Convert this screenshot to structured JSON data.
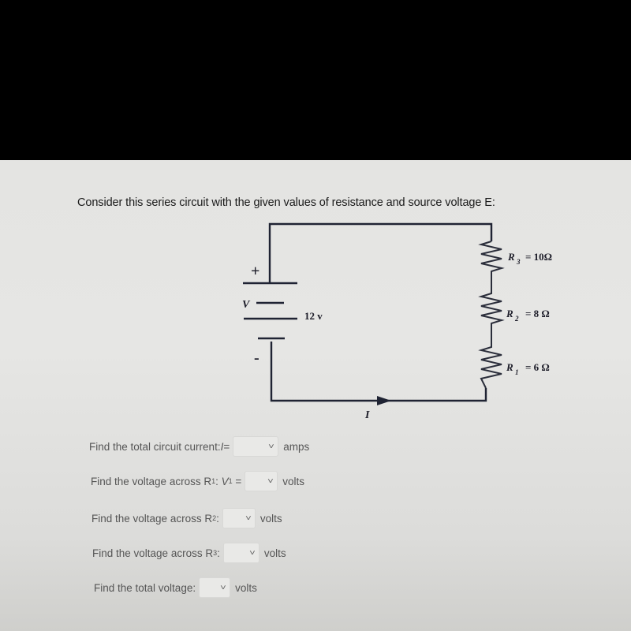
{
  "prompt": "Consider this series circuit with the given values of resistance and source voltage E:",
  "circuit": {
    "battery": {
      "plus_sign": "+",
      "minus_sign": "-",
      "symbol_label": "V",
      "voltage_label": "12 v"
    },
    "resistors": [
      {
        "name": "R",
        "sub": "3",
        "equals": "= 10Ω"
      },
      {
        "name": "R",
        "sub": "2",
        "equals": "= 8 Ω"
      },
      {
        "name": "R",
        "sub": "1",
        "equals": "= 6 Ω"
      }
    ],
    "current_label": "I",
    "current_arrow_icon": "arrow-right-icon"
  },
  "questions": [
    {
      "text": "Find the total circuit current: ",
      "var": "I",
      "var_sub": "",
      "suffix": "=",
      "unit": "amps",
      "value": ""
    },
    {
      "text": "Find the voltage across R",
      "sub": "1",
      "mid": ": ",
      "var": "V",
      "var_sub": "1",
      "suffix": " =",
      "unit": "volts",
      "value": ""
    },
    {
      "text": "Find the voltage across R",
      "sub": "2",
      "mid": ":",
      "unit": "volts",
      "value": ""
    },
    {
      "text": "Find the voltage across R",
      "sub": "3",
      "mid": ":",
      "unit": "volts",
      "value": ""
    },
    {
      "text": "Find the total voltage:",
      "unit": "volts",
      "value": ""
    }
  ],
  "dropdown_icon": "chevron-down-icon",
  "dropdown_glyph": "˅"
}
